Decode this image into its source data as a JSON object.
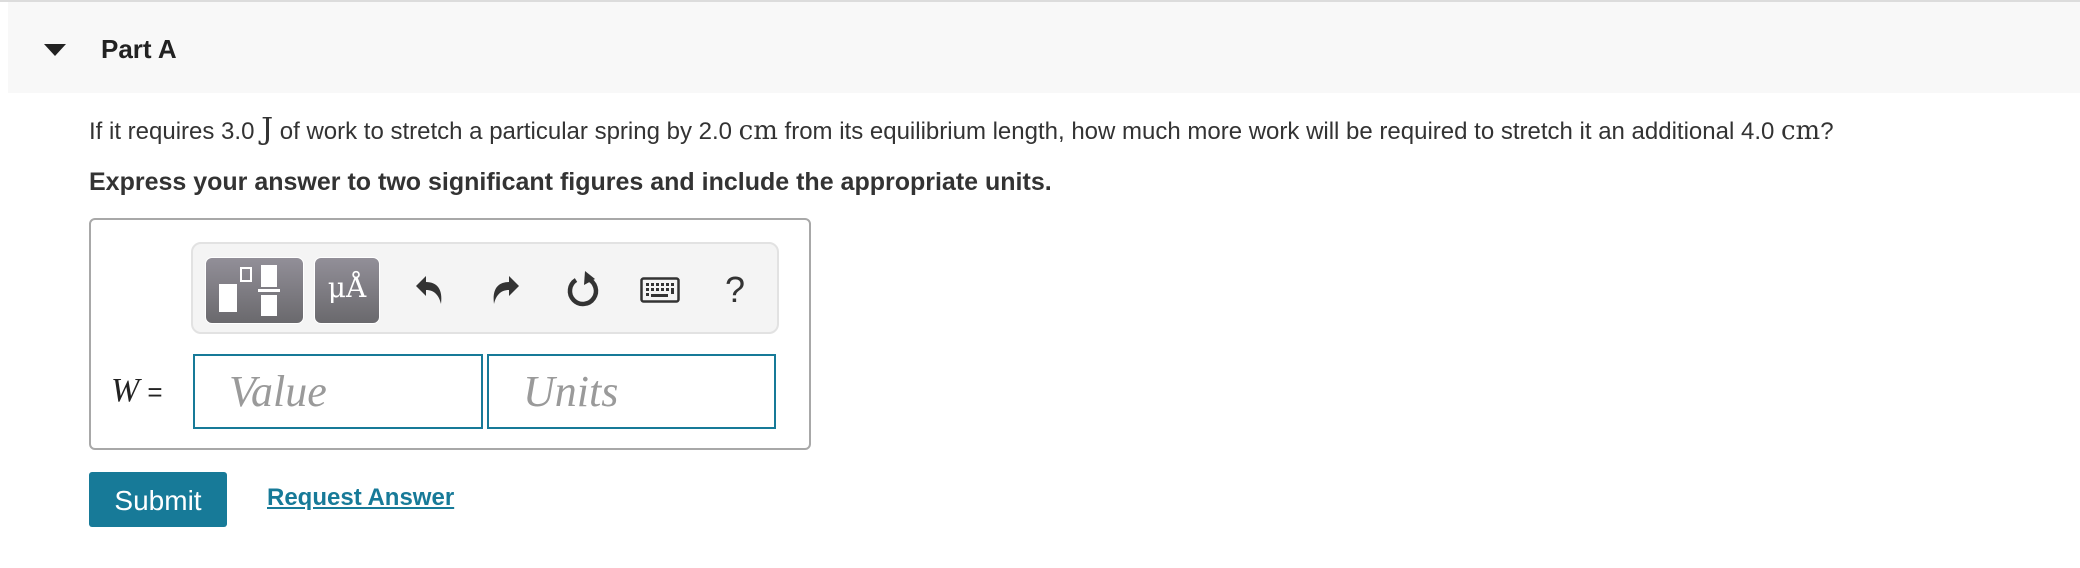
{
  "part": {
    "title": "Part A",
    "collapse_icon": "caret-down-icon"
  },
  "question": {
    "t1": "If it requires 3.0 ",
    "u1": "J",
    "t2": " of work to stretch a particular spring by 2.0 ",
    "u2": "cm",
    "t3": " from its equilibrium length, how much more work will be required to stretch it an additional 4.0 ",
    "u3": "cm",
    "t4": "?"
  },
  "instruction": "Express your answer to two significant figures and include the appropriate units.",
  "toolbar": {
    "templates_icon": "templates-icon",
    "units_label": "μÅ",
    "undo_icon": "undo-icon",
    "redo_icon": "redo-icon",
    "reset_icon": "reset-icon",
    "keyboard_icon": "keyboard-icon",
    "help_label": "?"
  },
  "answer": {
    "variable": "W",
    "equals": "=",
    "value": {
      "value": "",
      "placeholder": "Value"
    },
    "units": {
      "value": "",
      "placeholder": "Units"
    }
  },
  "actions": {
    "submit_label": "Submit",
    "request_label": "Request Answer"
  },
  "colors": {
    "accent": "#177a98",
    "header_bg": "#f8f8f8",
    "toolbar_button": "#7d7b82"
  }
}
